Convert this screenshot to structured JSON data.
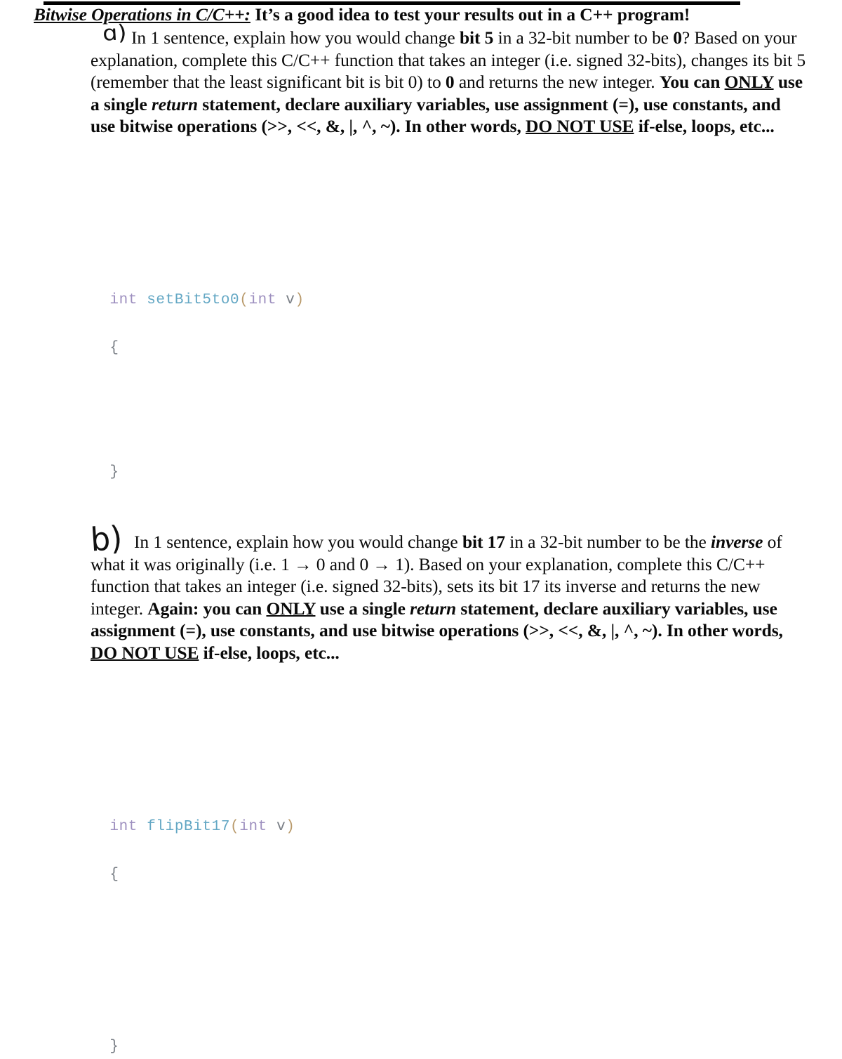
{
  "document": {
    "top_rule": true,
    "title": {
      "heading": "Bitwise Operations in C/C++:",
      "subtitle": "It’s a good idea to test your results out in a C++ program!"
    }
  },
  "questions": [
    {
      "marker": "a)",
      "marker_glyph": "ɑ)",
      "body_plain": "In 1 sentence, explain how you would change bit 5 in a 32-bit number to be 0? Based on your explanation, complete this C/C++ function that takes an integer (i.e. signed 32-bits), changes its bit 5 (remember that the least significant bit is bit 0) to 0 and returns the new integer. You can ONLY use a single return statement, declare auxiliary variables, use assignment (=), use constants, and use bitwise operations (>>, <<, &, |, ^, ~). In other words, DO NOT USE if-else, loops, etc...",
      "segments": [
        {
          "text": "In 1 sentence, explain how you would change ",
          "style": "normal"
        },
        {
          "text": "bit 5",
          "style": "bold"
        },
        {
          "text": " in a 32-bit number to be ",
          "style": "normal"
        },
        {
          "text": "0",
          "style": "bold"
        },
        {
          "text": "? Based on your explanation, complete this C/C++ function that takes an integer (i.e. signed 32-bits), changes its bit 5 (remember that the least significant bit is bit 0) to ",
          "style": "normal"
        },
        {
          "text": "0",
          "style": "bold"
        },
        {
          "text": " and returns the new integer. ",
          "style": "normal"
        },
        {
          "text": "You can ",
          "style": "bold"
        },
        {
          "text": "ONLY",
          "style": "bold-underline"
        },
        {
          "text": " use a single ",
          "style": "bold"
        },
        {
          "text": "return",
          "style": "bold-italic"
        },
        {
          "text": " statement, declare auxiliary variables, use assignment (=), use constants, and use bitwise operations (>>, <<, &, |, ^, ~). In other words, ",
          "style": "bold"
        },
        {
          "text": "DO NOT USE",
          "style": "bold-underline"
        },
        {
          "text": " if-else, loops, etc...",
          "style": "bold"
        }
      ],
      "code": {
        "signature_tokens": [
          {
            "text": "int",
            "type": "keyword"
          },
          {
            "text": " ",
            "type": "plain"
          },
          {
            "text": "setBit5to0",
            "type": "function"
          },
          {
            "text": "(",
            "type": "punct"
          },
          {
            "text": "int",
            "type": "keyword"
          },
          {
            "text": " ",
            "type": "plain"
          },
          {
            "text": "v",
            "type": "variable"
          },
          {
            "text": ")",
            "type": "punct"
          }
        ],
        "open_brace": "{",
        "close_brace": "}",
        "body": ""
      }
    },
    {
      "marker": "b)",
      "marker_glyph": "b)",
      "body_plain": "In 1 sentence, explain how you would change bit 17 in a 32-bit number to be the inverse of what it was originally (i.e. 1 → 0 and 0 → 1). Based on your explanation, complete this C/C++ function that takes an integer (i.e. signed 32-bits), sets its bit 17 its inverse and returns the new integer. Again: you can ONLY use a single return statement, declare auxiliary variables, use assignment (=), use constants, and use bitwise operations (>>, <<, &, |, ^, ~). In other words, DO NOT USE if-else, loops, etc...",
      "segments": [
        {
          "text": "In 1 sentence, explain how you would change ",
          "style": "normal"
        },
        {
          "text": "bit 17",
          "style": "bold"
        },
        {
          "text": " in a 32-bit number to be the ",
          "style": "normal"
        },
        {
          "text": "inverse",
          "style": "bold-italic"
        },
        {
          "text": " of what it was originally (i.e. 1 → 0 and 0 → 1). Based on your explanation, complete this C/C++ function that takes an integer (i.e. signed 32-bits), sets its bit 17 its inverse and returns the new integer. ",
          "style": "normal"
        },
        {
          "text": "Again: you can ",
          "style": "bold"
        },
        {
          "text": "ONLY",
          "style": "bold-underline"
        },
        {
          "text": " use a single ",
          "style": "bold"
        },
        {
          "text": "return",
          "style": "bold-italic"
        },
        {
          "text": " statement, declare auxiliary variables, use assignment (=), use constants, and use bitwise operations (>>, <<, &, |, ^, ~). In other words, ",
          "style": "bold"
        },
        {
          "text": "DO NOT USE",
          "style": "bold-underline"
        },
        {
          "text": " if-else, loops, etc...",
          "style": "bold"
        }
      ],
      "code": {
        "signature_tokens": [
          {
            "text": "int",
            "type": "keyword"
          },
          {
            "text": " ",
            "type": "plain"
          },
          {
            "text": "flipBit17",
            "type": "function"
          },
          {
            "text": "(",
            "type": "punct"
          },
          {
            "text": "int",
            "type": "keyword"
          },
          {
            "text": " ",
            "type": "plain"
          },
          {
            "text": "v",
            "type": "variable"
          },
          {
            "text": ")",
            "type": "punct"
          }
        ],
        "open_brace": "{",
        "close_brace": "}",
        "body": ""
      }
    }
  ],
  "colors": {
    "page_background": "#ffffff",
    "text": "#0a0a0a",
    "rule": "#000000",
    "code_keyword": "#9d8fbf",
    "code_function": "#63a7c4",
    "code_punct": "#b99a6b",
    "code_variable": "#7a7f86",
    "code_brace": "#7a7f86"
  }
}
